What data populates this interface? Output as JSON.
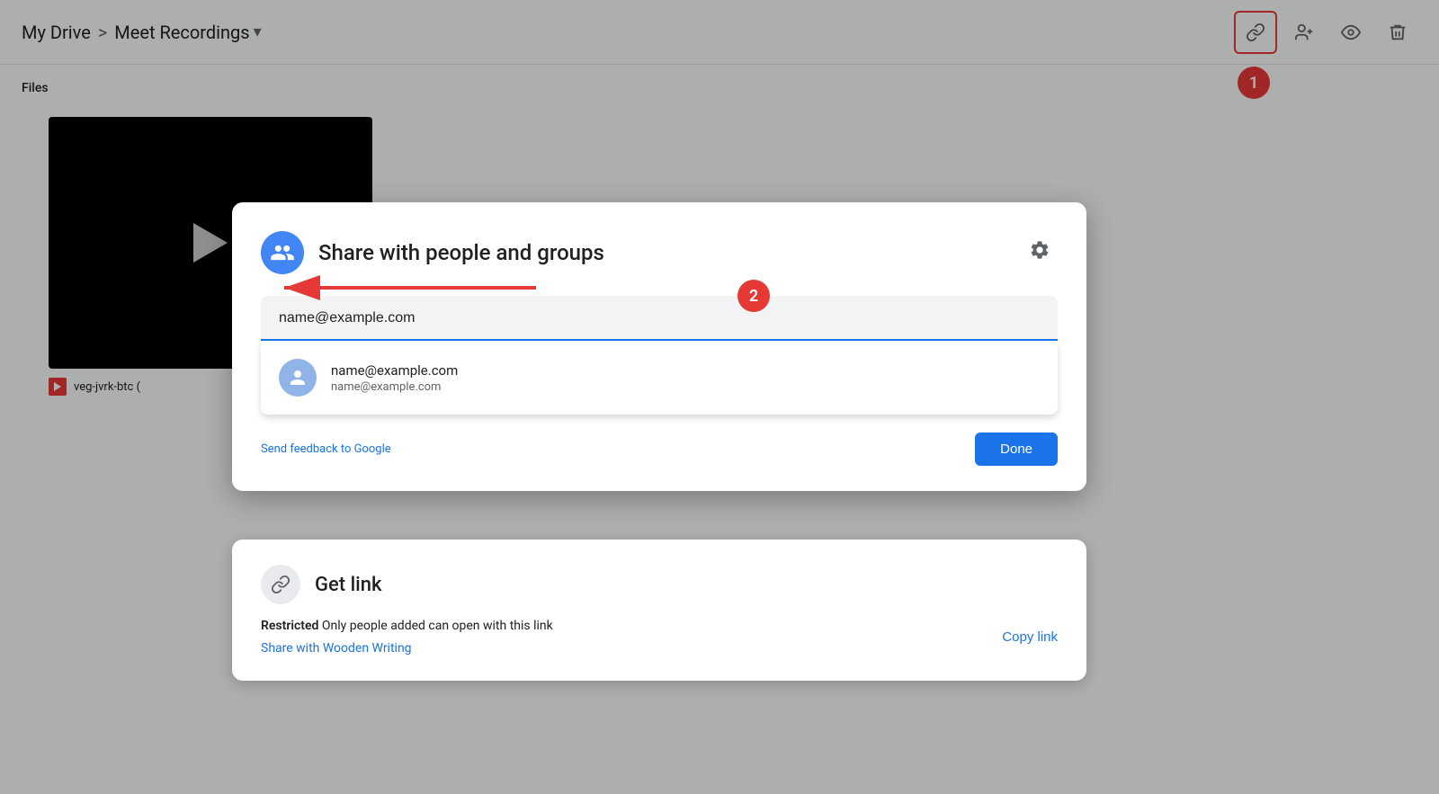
{
  "header": {
    "breadcrumb": {
      "root": "My Drive",
      "separator": ">",
      "current": "Meet Recordings",
      "chevron": "▾"
    },
    "actions": {
      "link_icon": "🔗",
      "add_person_icon": "👤+",
      "eye_icon": "👁",
      "trash_icon": "🗑"
    }
  },
  "files_section": {
    "label": "Files",
    "file_name": "veg-jvrk-btc ("
  },
  "step_badges": {
    "step1": "1",
    "step2": "2"
  },
  "share_dialog": {
    "title": "Share with people and groups",
    "input_value": "name@example.com",
    "suggestion": {
      "name": "name@example.com",
      "email": "name@example.com"
    },
    "feedback_link": "Send feedback to Google",
    "done_button": "Done"
  },
  "get_link_dialog": {
    "title": "Get link",
    "description_bold": "Restricted",
    "description_text": " Only people added can open with this link",
    "share_link_text": "Share with Wooden Writing",
    "copy_link_button": "Copy link"
  }
}
